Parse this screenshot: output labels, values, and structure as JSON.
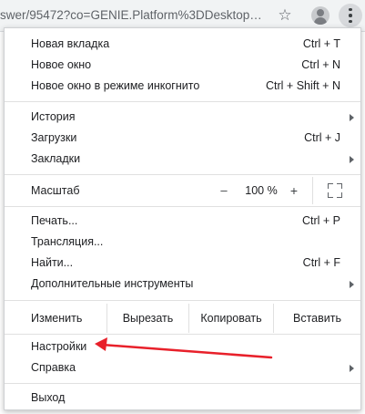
{
  "browser": {
    "url_text": "swer/95472?co=GENIE.Platform%3DDesktop…",
    "bookmark_icon": "star-icon",
    "profile_icon": "avatar-icon",
    "menu_icon": "kebab-menu-icon"
  },
  "menu": {
    "group1": [
      {
        "label": "Новая вкладка",
        "shortcut": "Ctrl + T"
      },
      {
        "label": "Новое окно",
        "shortcut": "Ctrl + N"
      },
      {
        "label": "Новое окно в режиме инкогнито",
        "shortcut": "Ctrl + Shift + N"
      }
    ],
    "group2": [
      {
        "label": "История",
        "submenu": true
      },
      {
        "label": "Загрузки",
        "shortcut": "Ctrl + J"
      },
      {
        "label": "Закладки",
        "submenu": true
      }
    ],
    "zoom": {
      "label": "Масштаб",
      "minus": "–",
      "value": "100 %",
      "plus": "+",
      "fullscreen_icon": "fullscreen-icon"
    },
    "group3": [
      {
        "label": "Печать...",
        "shortcut": "Ctrl + P"
      },
      {
        "label": "Трансляция..."
      },
      {
        "label": "Найти...",
        "shortcut": "Ctrl + F"
      },
      {
        "label": "Дополнительные инструменты",
        "submenu": true
      }
    ],
    "edit": {
      "label": "Изменить",
      "cut": "Вырезать",
      "copy": "Копировать",
      "paste": "Вставить"
    },
    "group4": [
      {
        "label": "Настройки"
      },
      {
        "label": "Справка",
        "submenu": true
      }
    ],
    "exit": {
      "label": "Выход"
    }
  },
  "annotation": {
    "color": "#e8202a"
  },
  "colors": {
    "menu_bg": "#ffffff",
    "toolbar_bg": "#f1f3f4",
    "text": "#202124"
  }
}
